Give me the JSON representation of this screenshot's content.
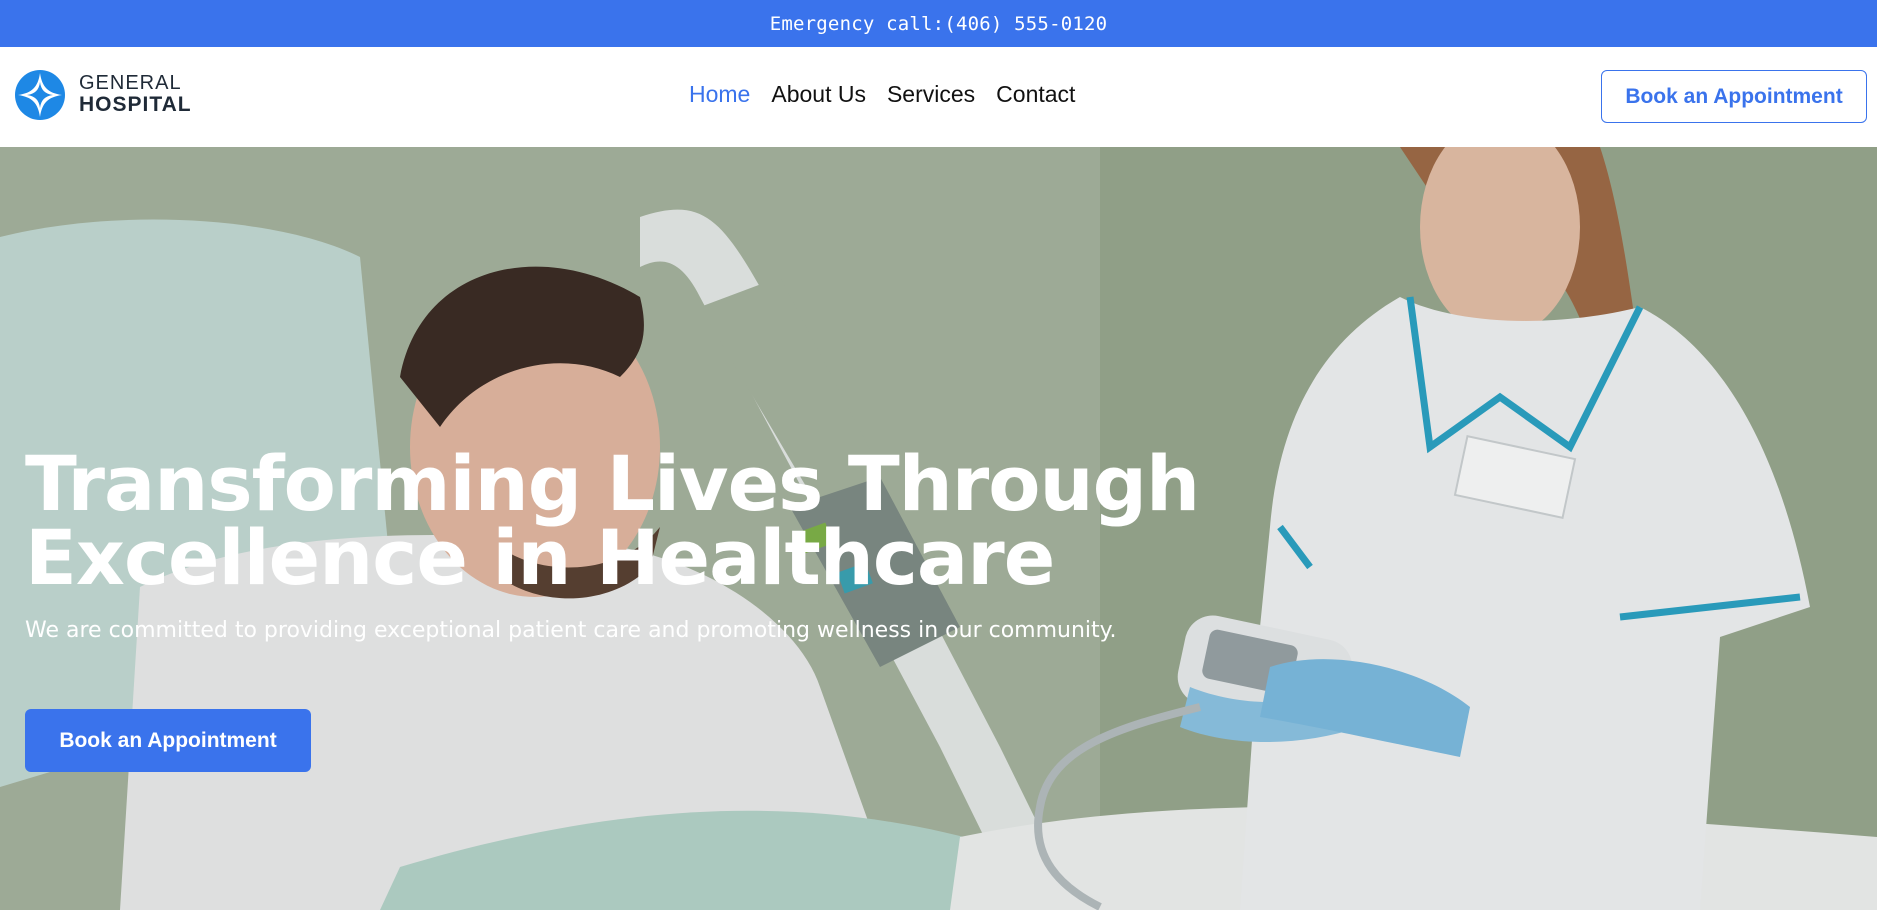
{
  "topbar": {
    "emergency_text": "Emergency call:(406) 555-0120"
  },
  "brand": {
    "name_line1": "GENERAL",
    "name_line2": "HOSPITAL",
    "logo_icon": "four-point-star-circle-icon",
    "color": "#1e88e5"
  },
  "nav": {
    "items": [
      {
        "label": "Home",
        "active": true
      },
      {
        "label": "About Us",
        "active": false
      },
      {
        "label": "Services",
        "active": false
      },
      {
        "label": "Contact",
        "active": false
      }
    ],
    "cta_label": "Book an Appointment"
  },
  "hero": {
    "title": "Transforming Lives Through Excellence in Healthcare",
    "subtitle": "We are committed to providing exceptional patient care and promoting wellness in our community.",
    "cta_label": "Book an Appointment",
    "image": "patient-in-hospital-bed-with-nurse-photo"
  },
  "colors": {
    "accent": "#3a73ec",
    "text_dark": "#111111",
    "white": "#ffffff"
  }
}
